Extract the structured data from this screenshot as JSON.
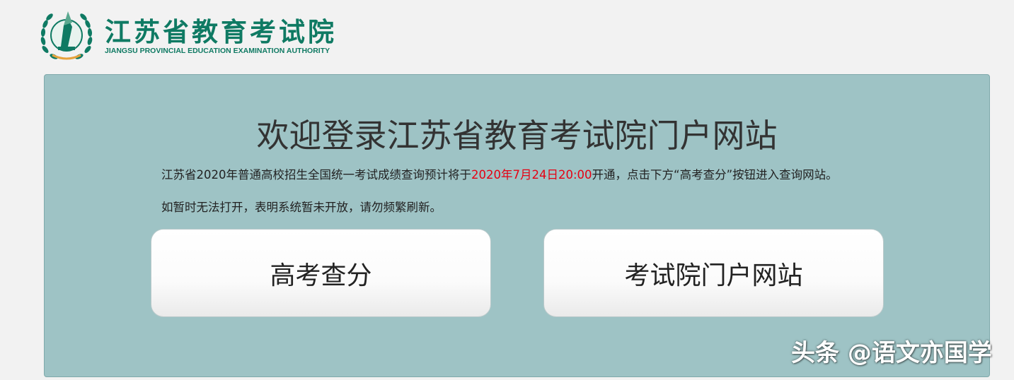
{
  "header": {
    "title_cn": "江苏省教育考试院",
    "title_en": "JIANGSU PROVINCIAL EDUCATION EXAMINATION AUTHORITY"
  },
  "main": {
    "welcome": "欢迎登录江苏省教育考试院门户网站",
    "notice_line1_before": "江苏省2020年普通高校招生全国统一考试成绩查询预计将于",
    "notice_line1_time": "2020年7月24日20:00",
    "notice_line1_after": "开通，点击下方“高考查分”按钮进入查询网站。",
    "notice_line2": "如暂时无法打开，表明系统暂未开放，请勿频繁刷新。",
    "button_score": "高考查分",
    "button_portal": "考试院门户网站"
  },
  "watermark": "头条 @语文亦国学",
  "colors": {
    "brand_green": "#0f7a63",
    "panel_bg": "#9ec3c5",
    "highlight_red": "#e60012"
  },
  "icons": {
    "logo": "emblem-icon"
  }
}
